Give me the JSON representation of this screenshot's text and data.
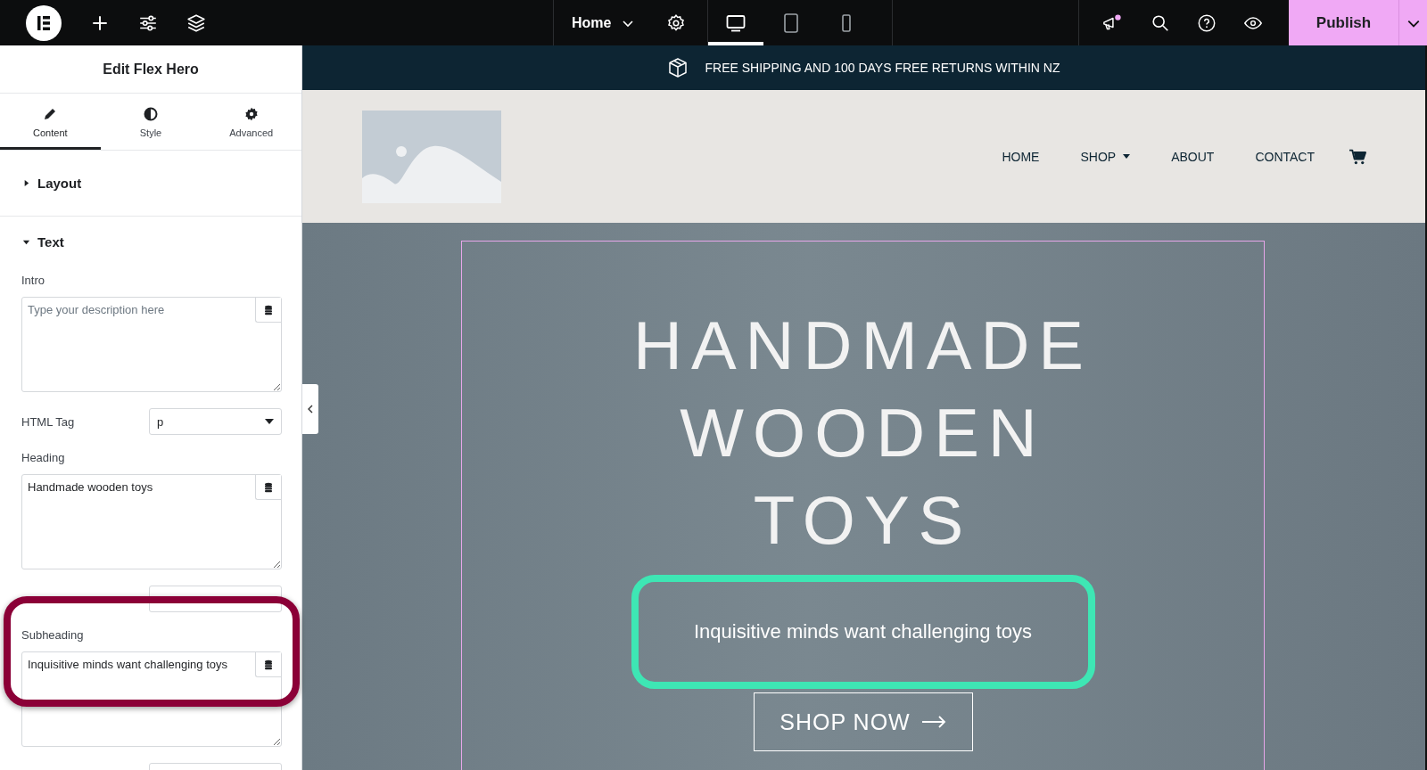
{
  "topbar": {
    "page_menu": "Home",
    "publish": "Publish",
    "devices": [
      {
        "kind": "desktop",
        "selected": true
      },
      {
        "kind": "tablet",
        "selected": false
      },
      {
        "kind": "mobile",
        "selected": false
      }
    ]
  },
  "panel": {
    "title": "Edit Flex Hero",
    "tabs": [
      {
        "label": "Content",
        "kind": "pencil",
        "selected": true
      },
      {
        "label": "Style",
        "kind": "contrast",
        "selected": false
      },
      {
        "label": "Advanced",
        "kind": "gear",
        "selected": false
      }
    ],
    "sections": [
      {
        "label": "Layout",
        "expanded": false
      },
      {
        "label": "Text",
        "expanded": true
      }
    ],
    "fields": [
      {
        "kind": "textarea",
        "label": "Intro",
        "placeholder": "Type your description here"
      },
      {
        "kind": "select",
        "label": "HTML Tag",
        "value": "p"
      },
      {
        "kind": "textarea",
        "label": "Heading",
        "value": "Handmade wooden toys"
      },
      {
        "kind": "select"
      },
      {
        "kind": "textarea",
        "label": "Subheading",
        "value": "Inquisitive minds want challenging toys",
        "highlighted": true
      },
      {
        "kind": "select"
      }
    ]
  },
  "banner": {
    "text": "FREE SHIPPING AND 100 DAYS FREE RETURNS WITHIN NZ"
  },
  "nav": {
    "items": [
      {
        "label": "HOME",
        "kind": "link"
      },
      {
        "label": "SHOP",
        "kind": "dropdown"
      },
      {
        "label": "ABOUT",
        "kind": "link"
      },
      {
        "label": "CONTACT",
        "kind": "link"
      }
    ]
  },
  "hero": {
    "heading": "HANDMADE WOODEN TOYS",
    "subheading": "Inquisitive minds want challenging toys",
    "subheading_highlighted": true,
    "button": "SHOP NOW"
  }
}
